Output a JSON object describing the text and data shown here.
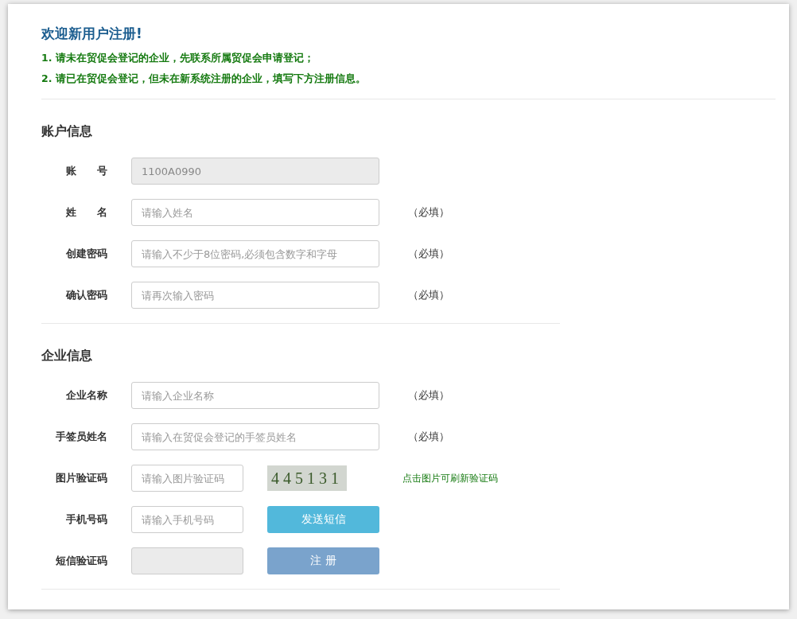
{
  "welcome": {
    "title": "欢迎新用户注册!",
    "notes": [
      "1. 请未在贸促会登记的企业，先联系所属贸促会申请登记；",
      "2. 请已在贸促会登记，但未在新系统注册的企业，填写下方注册信息。"
    ]
  },
  "sections": [
    {
      "title": "账户信息",
      "rows": [
        {
          "kind": "text",
          "label": "账　　号",
          "value": "1100A0990",
          "disabled": true
        },
        {
          "kind": "text",
          "label": "姓　　名",
          "placeholder": "请输入姓名",
          "disabled": false,
          "note": "（必填）"
        },
        {
          "kind": "text",
          "label": "创建密码",
          "placeholder": "请输入不少于8位密码,必须包含数字和字母",
          "disabled": false,
          "note": "（必填）"
        },
        {
          "kind": "text",
          "label": "确认密码",
          "placeholder": "请再次输入密码",
          "disabled": false,
          "note": "（必填）"
        }
      ]
    },
    {
      "title": "企业信息",
      "rows": [
        {
          "kind": "text",
          "label": "企业名称",
          "placeholder": "请输入企业名称",
          "disabled": false,
          "note": "（必填）"
        },
        {
          "kind": "text",
          "label": "手签员姓名",
          "placeholder": "请输入在贸促会登记的手签员姓名",
          "disabled": false,
          "note": "（必填）"
        },
        {
          "kind": "captcha",
          "label": "图片验证码",
          "placeholder": "请输入图片验证码",
          "disabled": false,
          "captcha": "445131",
          "hint": "点击图片可刷新验证码"
        },
        {
          "kind": "sms",
          "label": "手机号码",
          "placeholder": "请输入手机号码",
          "disabled": false,
          "button": "发送短信"
        },
        {
          "kind": "submit",
          "label": "短信验证码",
          "disabled": true,
          "button": "注 册"
        }
      ]
    }
  ]
}
